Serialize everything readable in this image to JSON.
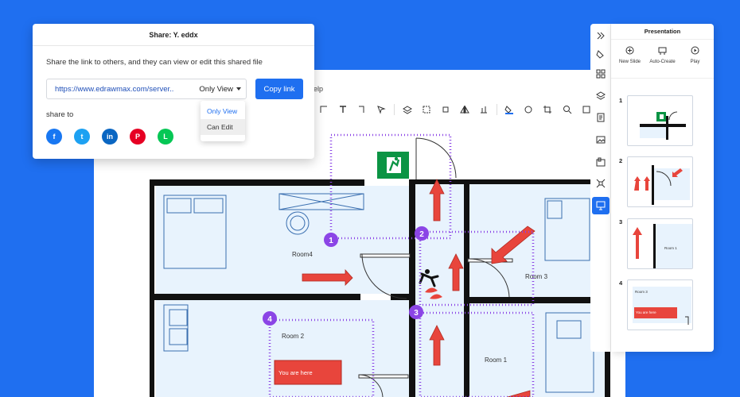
{
  "share_dialog": {
    "title": "Share: Y. eddx",
    "description": "Share the link to others, and they can view or edit this shared file",
    "link_url": "https://www.edrawmax.com/server..",
    "permission": "Only View",
    "copy_label": "Copy link",
    "share_to_label": "share to",
    "permission_options": [
      "Only View",
      "Can Edit"
    ],
    "socials": [
      {
        "name": "facebook",
        "glyph": "f",
        "color": "#1877f2"
      },
      {
        "name": "twitter",
        "glyph": "t",
        "color": "#1da1f2"
      },
      {
        "name": "linkedin",
        "glyph": "in",
        "color": "#0a66c2"
      },
      {
        "name": "pinterest",
        "glyph": "P",
        "color": "#e60023"
      },
      {
        "name": "line",
        "glyph": "L",
        "color": "#06c755"
      }
    ]
  },
  "editor": {
    "menu_fragment": "elp"
  },
  "floor_plan": {
    "rooms": [
      "Room4",
      "Room 3",
      "Room 2",
      "Room 1"
    ],
    "you_are_here": "You are here",
    "steps": [
      "1",
      "2",
      "3",
      "4"
    ]
  },
  "presentation": {
    "title": "Presentation",
    "actions": [
      {
        "label": "New Slide",
        "icon": "plus-circle-icon"
      },
      {
        "label": "Auto-Create",
        "icon": "auto-create-icon"
      },
      {
        "label": "Play",
        "icon": "play-icon"
      }
    ],
    "slides": [
      {
        "number": "1"
      },
      {
        "number": "2"
      },
      {
        "number": "3",
        "room_label": "Room 1"
      },
      {
        "number": "4",
        "room_label": "Room 3",
        "you_are_here": "You are here"
      }
    ]
  },
  "colors": {
    "background": "#1f6ff0",
    "accent": "#1f6ff0",
    "arrow_red": "#e8453c",
    "step_purple": "#8b45e6",
    "room_fill": "#e8f3fd",
    "exit_green": "#0b9444"
  }
}
